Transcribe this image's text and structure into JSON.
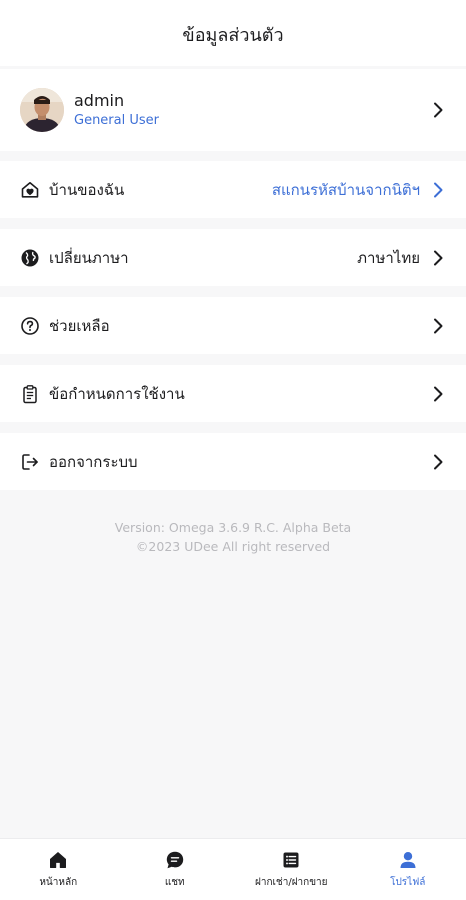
{
  "header": {
    "title": "ข้อมูลส่วนตัว"
  },
  "profile": {
    "name": "admin",
    "role": "General User"
  },
  "menu": [
    {
      "label": "บ้านของฉัน",
      "value": "สแกนรหัสบ้านจากนิติฯ",
      "icon": "home-heart-icon"
    },
    {
      "label": "เปลี่ยนภาษา",
      "value": "ภาษาไทย",
      "icon": "globe-icon"
    },
    {
      "label": "ช่วยเหลือ",
      "value": "",
      "icon": "help-circle-icon"
    },
    {
      "label": "ข้อกำหนดการใช้งาน",
      "value": "",
      "icon": "clipboard-icon"
    },
    {
      "label": "ออกจากระบบ",
      "value": "",
      "icon": "logout-icon"
    }
  ],
  "footer": {
    "version": "Version: Omega 3.6.9 R.C. Alpha Beta",
    "copyright": "©2023 UDee All right reserved"
  },
  "tabs": [
    {
      "label": "หน้าหลัก",
      "icon": "home-icon"
    },
    {
      "label": "แชท",
      "icon": "chat-icon"
    },
    {
      "label": "ฝากเช่า/ฝากขาย",
      "icon": "list-icon"
    },
    {
      "label": "โปรไฟล์",
      "icon": "user-icon"
    }
  ],
  "colors": {
    "accent": "#3d6fd6",
    "background": "#f7f7f8",
    "text": "#1c1c1e",
    "muted": "#b9b9bd"
  }
}
